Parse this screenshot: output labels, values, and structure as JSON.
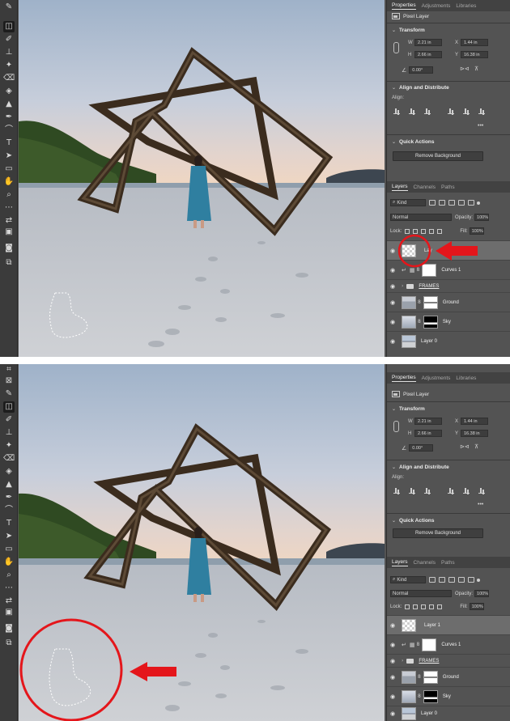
{
  "panel": {
    "tabs": [
      "Properties",
      "Adjustments",
      "Libraries"
    ],
    "pixel_layer": "Pixel Layer",
    "transform": {
      "title": "Transform",
      "w_label": "W",
      "w": "2.21 in",
      "x_label": "X",
      "x": "1.44 in",
      "h_label": "H",
      "h": "2.66 in",
      "y_label": "Y",
      "y": "16.38 in",
      "angle": "0.00°"
    },
    "align": {
      "title": "Align and Distribute",
      "label": "Align:"
    },
    "quick_actions": {
      "title": "Quick Actions",
      "remove_bg": "Remove Background"
    }
  },
  "layers_panel": {
    "tabs": [
      "Layers",
      "Channels",
      "Paths"
    ],
    "kind": "Kind",
    "blend_mode": "Normal",
    "opacity_label": "Opacity:",
    "opacity": "100%",
    "lock_label": "Lock:",
    "fill_label": "Fill:",
    "fill": "100%",
    "layers_top": [
      "Lay",
      "Curves 1",
      "FRAMES",
      "Ground",
      "Sky",
      "Layer 0"
    ],
    "layers_bottom": [
      "Layer 1",
      "Curves 1",
      "FRAMES",
      "Ground",
      "Sky",
      "Layer 0"
    ]
  },
  "colors": {
    "ui_dark": "#535353",
    "highlight_red": "#e4161b",
    "wood": "#4a3a2a",
    "dress": "#2f7fa0"
  },
  "icons": [
    "eyedropper-icon",
    "marquee-icon",
    "brush-icon",
    "stamp-icon",
    "healing-icon",
    "eraser-icon",
    "bucket-icon",
    "triangle-icon",
    "pen-icon",
    "type-icon",
    "path-select-icon",
    "rectangle-icon",
    "hand-icon",
    "zoom-icon",
    "more-icon",
    "swap-icon",
    "color-swatch-icon",
    "quickmask-icon",
    "screen-mode-icon"
  ]
}
